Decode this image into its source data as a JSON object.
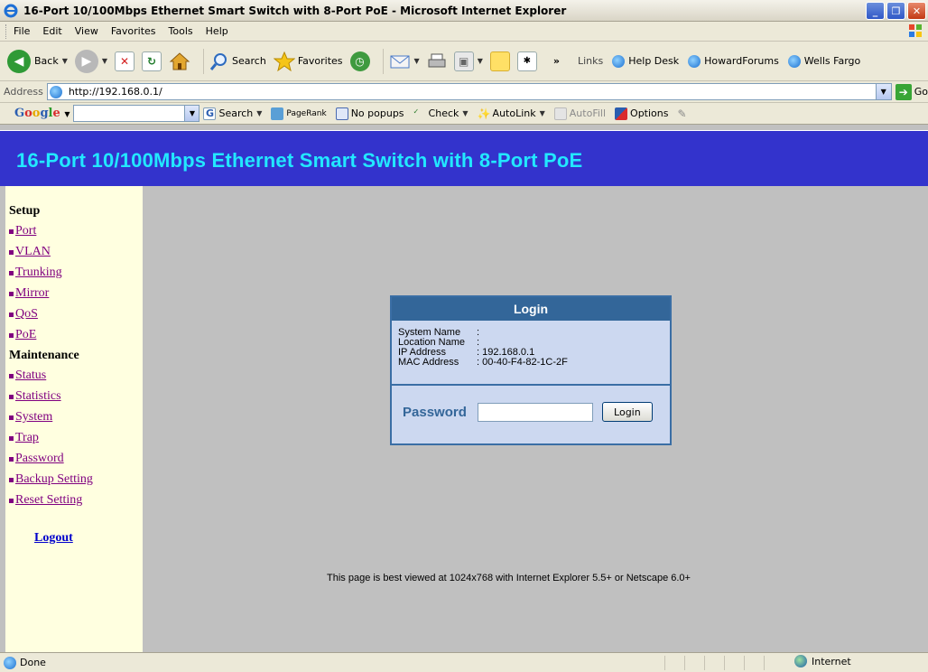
{
  "window": {
    "title": "16-Port 10/100Mbps Ethernet Smart Switch with 8-Port PoE - Microsoft Internet Explorer"
  },
  "menu": [
    "File",
    "Edit",
    "View",
    "Favorites",
    "Tools",
    "Help"
  ],
  "toolbar": {
    "back": "Back",
    "search": "Search",
    "favorites": "Favorites",
    "links_label": "Links",
    "links": [
      "Help Desk",
      "HowardForums",
      "Wells Fargo"
    ]
  },
  "address": {
    "label": "Address",
    "url": "http://192.168.0.1/",
    "go": "Go"
  },
  "google": {
    "logo": "Google",
    "search": "Search",
    "pagerank": "PageRank",
    "popups": "No popups",
    "check": "Check",
    "autolink": "AutoLink",
    "autofill": "AutoFill",
    "options": "Options"
  },
  "page": {
    "banner": "16-Port 10/100Mbps Ethernet Smart Switch with 8-Port PoE",
    "nav": {
      "setup_head": "Setup",
      "setup_items": [
        "Port",
        "VLAN",
        "Trunking",
        "Mirror",
        "QoS",
        "PoE"
      ],
      "maint_head": "Maintenance",
      "maint_items": [
        "Status",
        "Statistics",
        "System",
        "Trap",
        "Password",
        "Backup Setting",
        "Reset Setting"
      ],
      "logout": "Logout"
    },
    "login": {
      "title": "Login",
      "system_name_label": "System Name",
      "system_name_value": ":",
      "location_name_label": "Location Name",
      "location_name_value": ":",
      "ip_label": "IP Address",
      "ip_value": ": 192.168.0.1",
      "mac_label": "MAC Address",
      "mac_value": ": 00-40-F4-82-1C-2F",
      "password_label": "Password",
      "password_value": "",
      "button": "Login"
    },
    "footnote": "This page is best viewed at 1024x768 with Internet Explorer 5.5+ or Netscape 6.0+"
  },
  "status": {
    "text": "Done",
    "zone": "Internet"
  },
  "colors": {
    "banner_bg": "#3333cc",
    "banner_text": "#22e8ff",
    "nav_bg": "#ffffe0",
    "nav_link": "#800080",
    "login_header": "#336699",
    "login_body": "#ccd8f0",
    "page_bg": "#c0c0c0"
  }
}
